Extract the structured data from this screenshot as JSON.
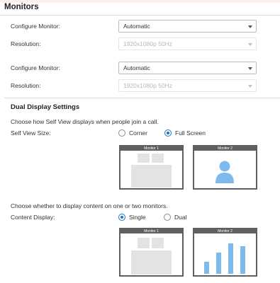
{
  "header": {
    "title": "Monitors"
  },
  "monitors": [
    {
      "configure_label": "Configure Monitor:",
      "configure_value": "Automatic",
      "resolution_label": "Resolution:",
      "resolution_value": "1920x1080p 50Hz"
    },
    {
      "configure_label": "Configure Monitor:",
      "configure_value": "Automatic",
      "resolution_label": "Resolution:",
      "resolution_value": "1920x1080p 50Hz"
    }
  ],
  "dual_display": {
    "title": "Dual Display Settings",
    "self_view_description": "Choose how Self View displays when people join a call.",
    "self_view_label": "Self View Size:",
    "self_view_options": [
      "Corner",
      "Full Screen"
    ],
    "self_view_selected": "Full Screen",
    "content_description": "Choose whether to display content on one or two monitors.",
    "content_label": "Content Display:",
    "content_options": [
      "Single",
      "Dual"
    ],
    "content_selected": "Single",
    "monitor_1_label": "Monitor 1",
    "monitor_2_label": "Monitor 2"
  },
  "colors": {
    "accent": "#1a73c8",
    "preview_blue": "#7dbbef",
    "monitor_frame": "#5f5f5f",
    "preview_gray": "#e3e3e3"
  },
  "icons": {
    "dropdown": "chevron-down-icon",
    "person": "person-silhouette-icon"
  }
}
